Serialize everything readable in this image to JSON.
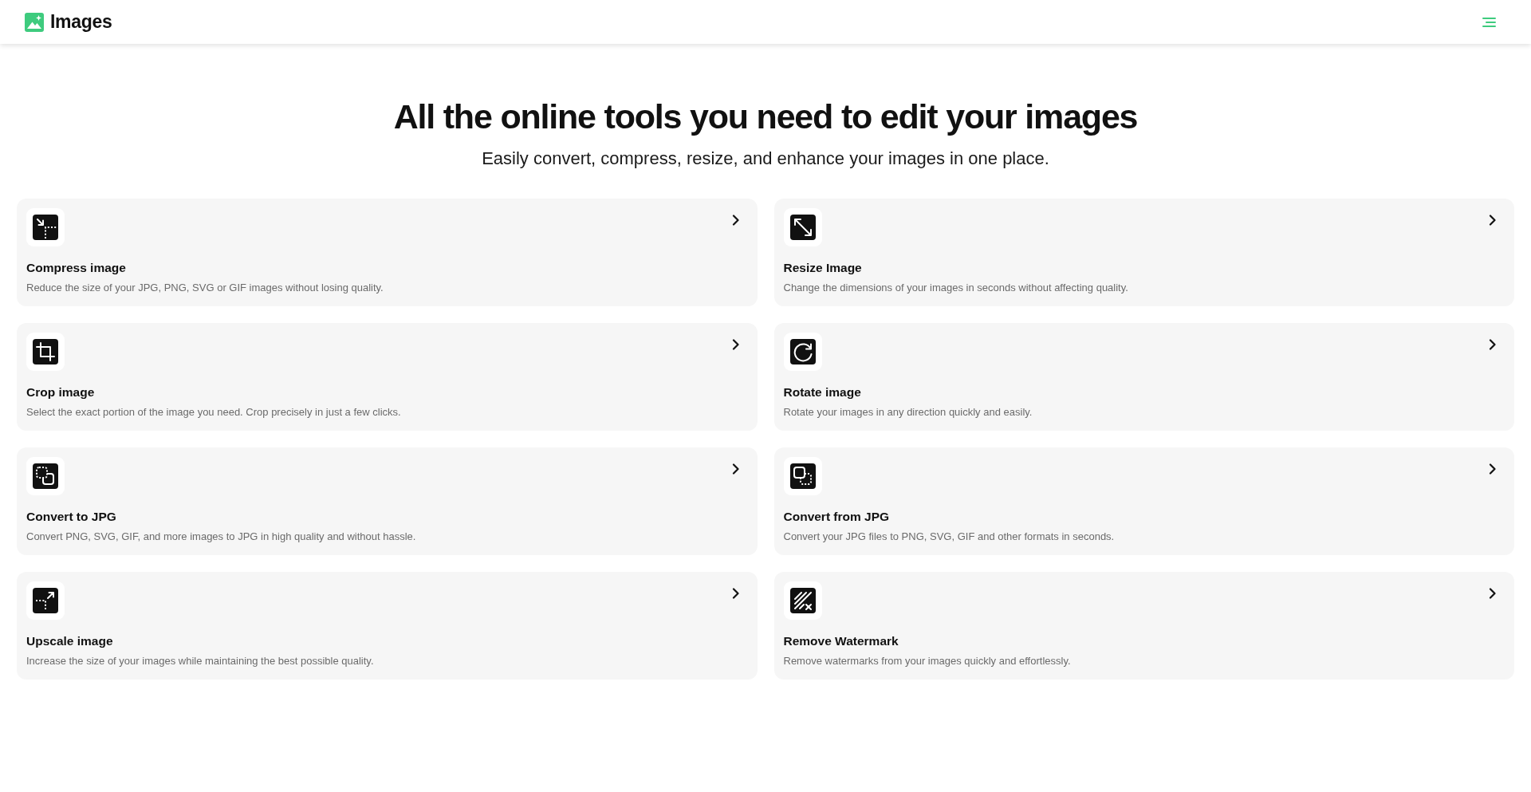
{
  "header": {
    "logo_text": "Images"
  },
  "hero": {
    "title": "All the online tools you need to edit your images",
    "subtitle": "Easily convert, compress, resize, and enhance your images in one place."
  },
  "tools": [
    {
      "kind": "compress",
      "title": "Compress image",
      "description": "Reduce the size of your JPG, PNG, SVG or GIF images without losing quality."
    },
    {
      "kind": "resize",
      "title": "Resize Image",
      "description": "Change the dimensions of your images in seconds without affecting quality."
    },
    {
      "kind": "crop",
      "title": "Crop image",
      "description": "Select the exact portion of the image you need. Crop precisely in just a few clicks."
    },
    {
      "kind": "rotate",
      "title": "Rotate image",
      "description": "Rotate your images in any direction quickly and easily."
    },
    {
      "kind": "to_jpg",
      "title": "Convert to JPG",
      "description": "Convert PNG, SVG, GIF, and more images to JPG in high quality and without hassle."
    },
    {
      "kind": "from_jpg",
      "title": "Convert from JPG",
      "description": "Convert your JPG files to PNG, SVG, GIF and other formats in seconds."
    },
    {
      "kind": "upscale",
      "title": "Upscale image",
      "description": "Increase the size of your images while maintaining the best possible quality."
    },
    {
      "kind": "watermark",
      "title": "Remove Watermark",
      "description": "Remove watermarks from your images quickly and effortlessly."
    }
  ]
}
